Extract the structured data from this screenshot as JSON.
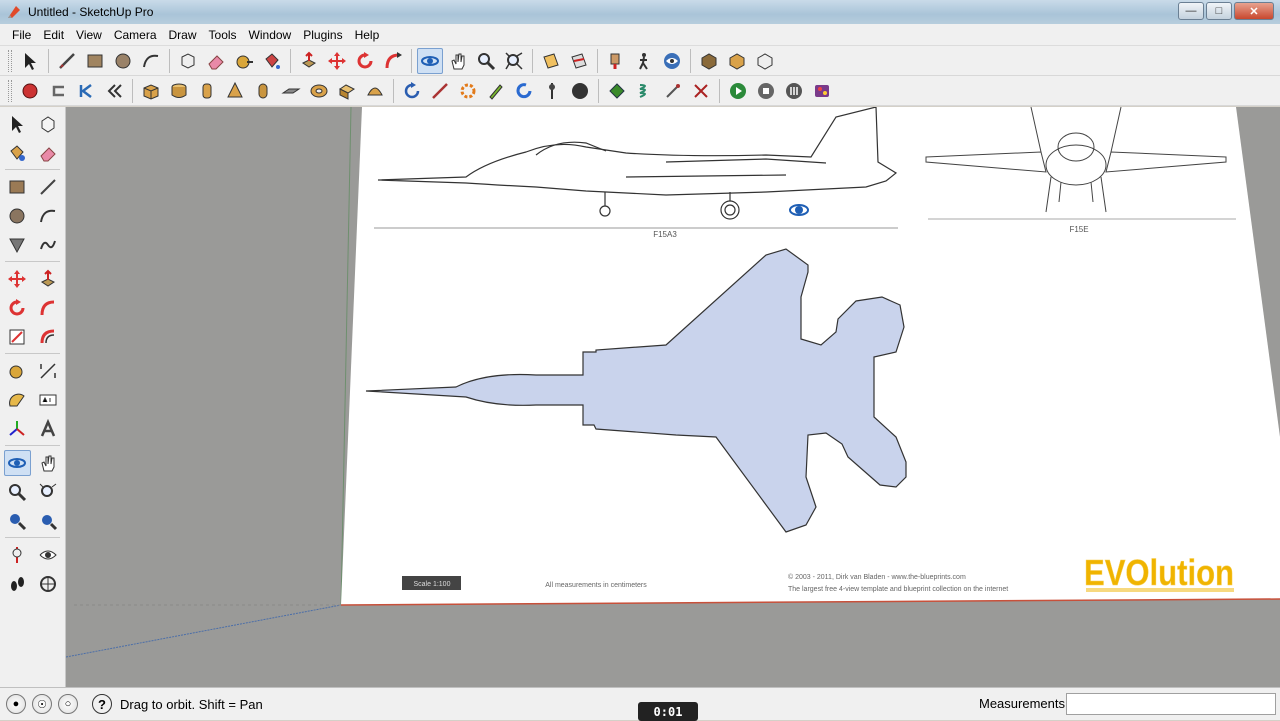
{
  "window": {
    "title": "Untitled - SketchUp Pro"
  },
  "menu": [
    "File",
    "Edit",
    "View",
    "Camera",
    "Draw",
    "Tools",
    "Window",
    "Plugins",
    "Help"
  ],
  "toolbar1": [
    "select",
    "line",
    "rectangle",
    "circle",
    "arc",
    "make-component",
    "eraser",
    "tape-measure",
    "paint-bucket",
    "push-pull",
    "move",
    "rotate",
    "follow-me",
    "orbit",
    "pan",
    "zoom",
    "zoom-extents",
    "section-plane",
    "section-display",
    "position-camera",
    "walk",
    "look-around",
    "google-earth",
    "get-models",
    "share-model",
    "component-builder"
  ],
  "toolbar2": [
    "record",
    "undo",
    "first",
    "previous",
    "box",
    "cylinder",
    "tube",
    "cone",
    "plane",
    "torus",
    "prism",
    "dome",
    "rotate-view",
    "line-tool",
    "gear",
    "pen",
    "refresh",
    "push-pin",
    "sphere",
    "leaf",
    "spring",
    "wand",
    "cross",
    "play",
    "stop",
    "settings",
    "palette"
  ],
  "drawing": {
    "side_label": "F15A3",
    "front_label": "F15E",
    "scale_label": "Scale 1:100",
    "measure_note": "All measurements in centimeters",
    "copyright_line1": "© 2003 - 2011, Dirk van Bladen - www.the-blueprints.com",
    "copyright_line2": "The largest free 4-view template and blueprint collection on the internet",
    "brand_logo": "EVOlution"
  },
  "status": {
    "message": "Drag to orbit.  Shift = Pan",
    "measurements_label": "Measurements",
    "measurements_value": "",
    "timer": "0:01"
  },
  "colors": {
    "viewport_bg": "#9a9a98",
    "aircraft_fill": "#c9d3ec",
    "paper": "#ffffff",
    "logo": "#f0b400"
  }
}
